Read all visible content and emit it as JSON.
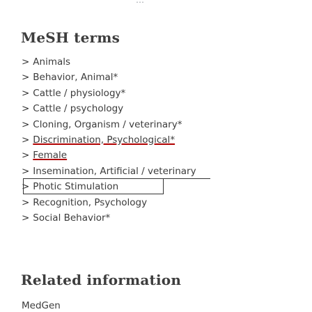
{
  "top_indicator": "⋯",
  "mesh_section": {
    "heading": "MeSH terms",
    "items": [
      {
        "label": "Animals"
      },
      {
        "label": "Behavior, Animal*"
      },
      {
        "label": "Cattle / physiology*"
      },
      {
        "label": "Cattle / psychology"
      },
      {
        "label": "Cloning, Organism / veterinary*"
      },
      {
        "label": "Discrimination, Psychological*"
      },
      {
        "label": "Female"
      },
      {
        "label": "Insemination, Artificial / veterinary"
      },
      {
        "label": "Photic Stimulation"
      },
      {
        "label": "Recognition, Psychology"
      },
      {
        "label": "Social Behavior*"
      }
    ]
  },
  "related_section": {
    "heading": "Related information",
    "links": [
      {
        "label": "MedGen"
      }
    ]
  },
  "colors": {
    "heading": "#3d3d3d",
    "text": "#3b3b3b",
    "highlight_underline": "#b00000"
  }
}
